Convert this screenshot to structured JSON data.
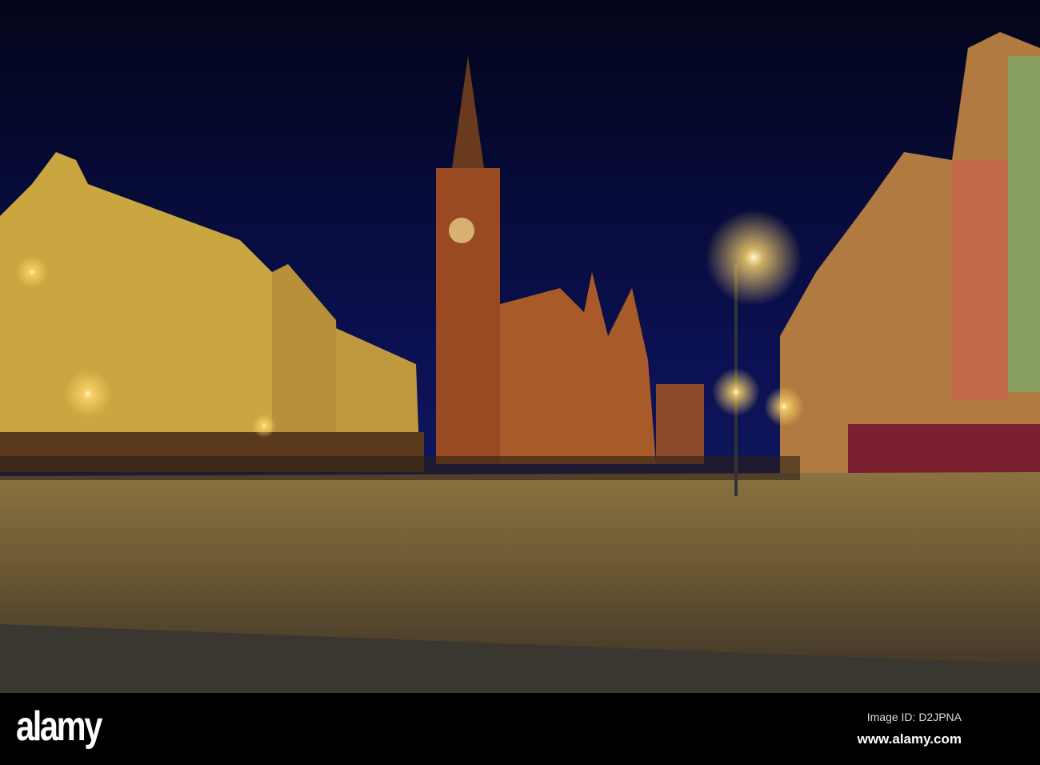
{
  "photo": {
    "subject": "Old Town Hall and Market Square at night",
    "watermark": "alamy"
  },
  "footer": {
    "logo": "alamy",
    "image_id": "Image ID: D2JPNA",
    "website": "www.alamy.com"
  },
  "colors": {
    "sky": "#060a2e",
    "lamp": "#ffd66b",
    "pavement": "#6b5a3a"
  }
}
